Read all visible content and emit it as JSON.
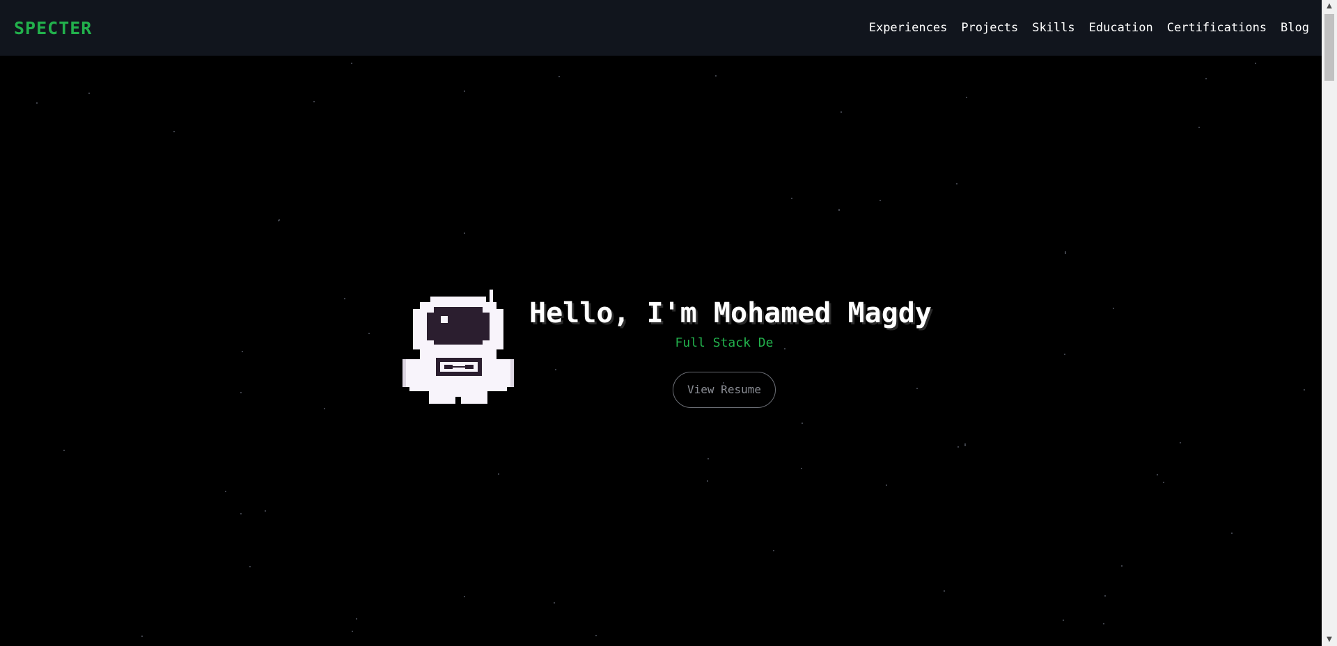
{
  "brand": {
    "logo_text": "SPECTER"
  },
  "nav": {
    "items": [
      {
        "label": "Experiences"
      },
      {
        "label": "Projects"
      },
      {
        "label": "Skills"
      },
      {
        "label": "Education"
      },
      {
        "label": "Certifications"
      },
      {
        "label": "Blog"
      }
    ]
  },
  "hero": {
    "title": "Hello, I'm Mohamed Magdy",
    "subtitle": "Full Stack De",
    "resume_button": "View Resume",
    "image_icon": "pixel-astronaut-icon"
  },
  "scrollbar": {
    "up_icon": "▲",
    "down_icon": "▼"
  },
  "colors": {
    "background": "#000000",
    "navbar": "#11151d",
    "accent": "#22b14c",
    "text": "#ffffff",
    "button_border": "#6b6e75"
  }
}
